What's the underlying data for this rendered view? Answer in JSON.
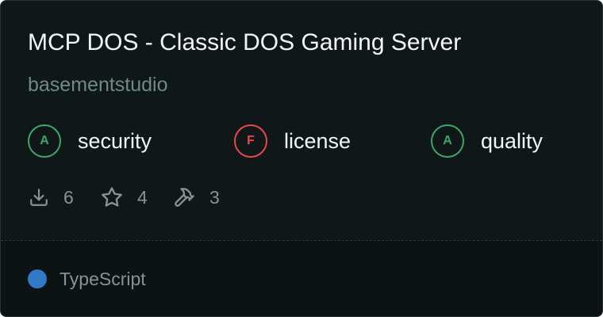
{
  "server": {
    "title": "MCP DOS - Classic DOS Gaming Server",
    "author": "basementstudio"
  },
  "scores": [
    {
      "grade": "A",
      "label": "security",
      "color": "#3aa66a",
      "text_color": "#3aa66a"
    },
    {
      "grade": "F",
      "label": "license",
      "color": "#e5484d",
      "text_color": "#e5484d"
    },
    {
      "grade": "A",
      "label": "quality",
      "color": "#3aa66a",
      "text_color": "#3aa66a"
    }
  ],
  "stats": {
    "downloads": {
      "icon": "download-icon",
      "value": "6"
    },
    "stars": {
      "icon": "star-icon",
      "value": "4"
    },
    "tools": {
      "icon": "hammer-icon",
      "value": "3"
    }
  },
  "language": {
    "name": "TypeScript",
    "color": "#3178c6"
  }
}
